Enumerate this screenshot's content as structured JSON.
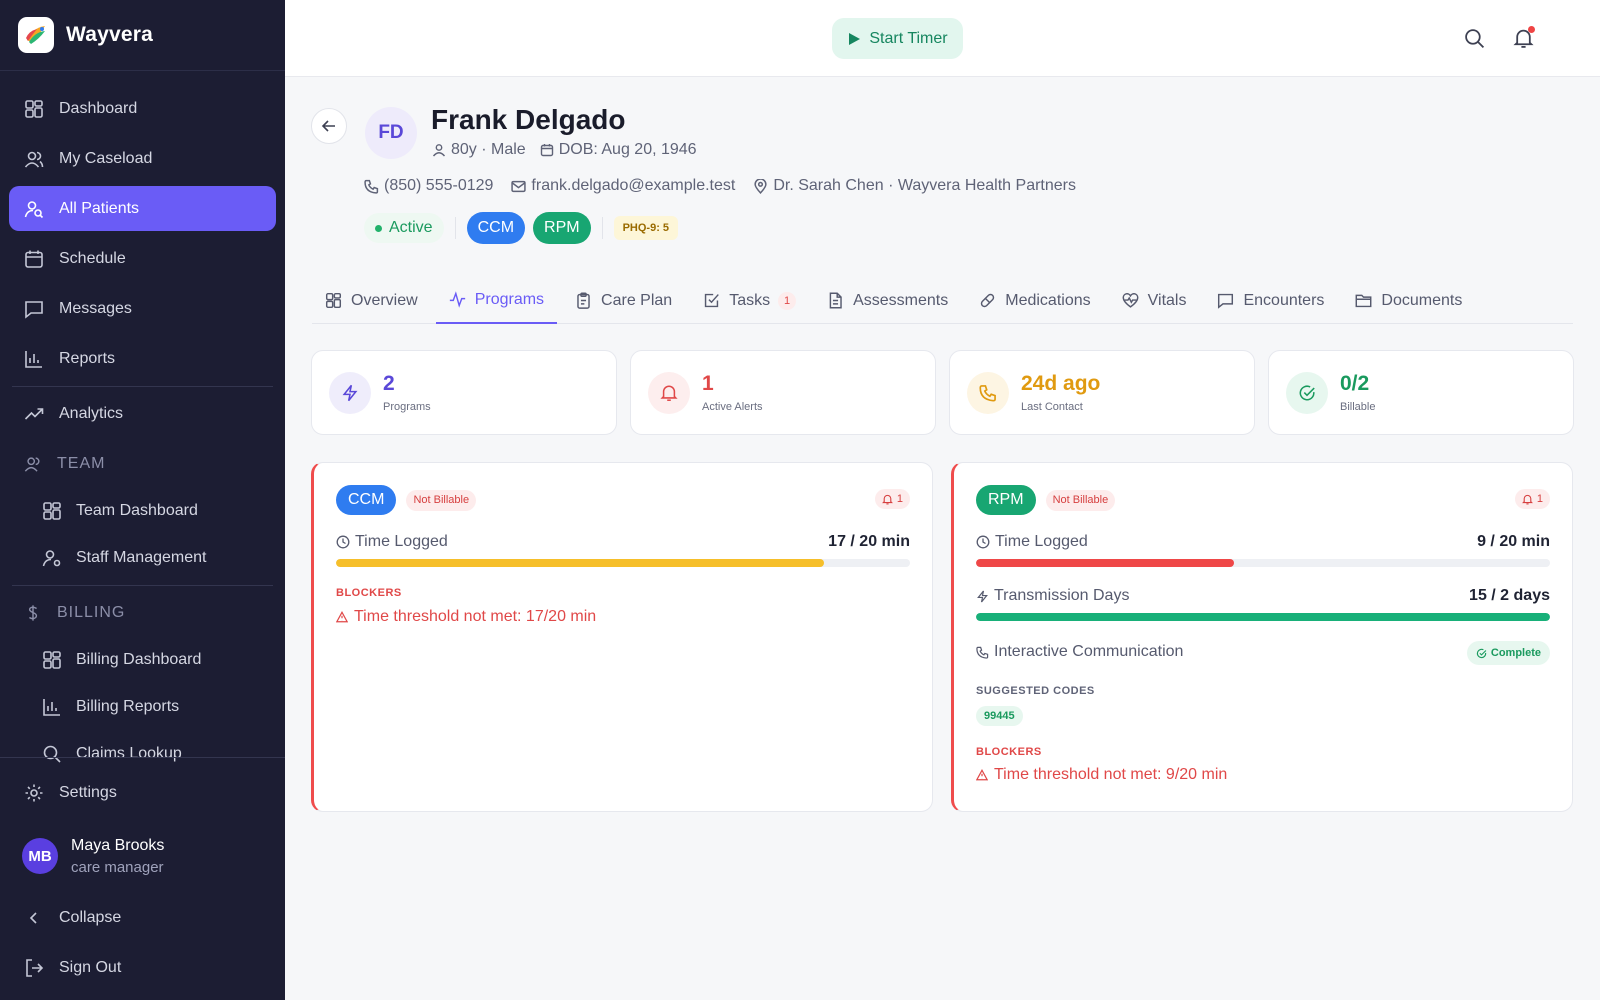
{
  "app": {
    "name": "Wayvera"
  },
  "sidebar": {
    "items": [
      {
        "label": "Dashboard",
        "icon": "grid-icon"
      },
      {
        "label": "My Caseload",
        "icon": "users-icon"
      },
      {
        "label": "All Patients",
        "icon": "user-search-icon",
        "active": true
      },
      {
        "label": "Schedule",
        "icon": "calendar-icon"
      },
      {
        "label": "Messages",
        "icon": "message-icon"
      },
      {
        "label": "Reports",
        "icon": "bar-chart-icon"
      }
    ],
    "analytics": {
      "label": "Analytics",
      "icon": "trending-icon"
    },
    "team": {
      "section": "TEAM",
      "items": [
        {
          "label": "Team Dashboard",
          "icon": "grid-icon"
        },
        {
          "label": "Staff Management",
          "icon": "user-cog-icon"
        }
      ]
    },
    "billing": {
      "section": "BILLING",
      "items": [
        {
          "label": "Billing Dashboard",
          "icon": "grid-icon"
        },
        {
          "label": "Billing Reports",
          "icon": "bar-chart-icon"
        },
        {
          "label": "Claims Lookup",
          "icon": "search-icon"
        }
      ]
    },
    "settings": "Settings",
    "user": {
      "initials": "MB",
      "name": "Maya Brooks",
      "role": "care manager"
    },
    "collapse": "Collapse",
    "sign_out": "Sign Out"
  },
  "topbar": {
    "timer_label": "Start Timer"
  },
  "patient": {
    "initials": "FD",
    "name": "Frank Delgado",
    "age_sex": "80y · Male",
    "dob": "DOB: Aug 20, 1946",
    "phone": "(850) 555-0129",
    "email": "frank.delgado@example.test",
    "provider": "Dr. Sarah Chen · Wayvera Health Partners",
    "status": "Active",
    "programs": [
      "CCM",
      "RPM"
    ],
    "phq": "PHQ-9: 5"
  },
  "tabs": [
    {
      "label": "Overview",
      "icon": "grid-icon"
    },
    {
      "label": "Programs",
      "icon": "activity-icon",
      "active": true
    },
    {
      "label": "Care Plan",
      "icon": "clipboard-icon"
    },
    {
      "label": "Tasks",
      "icon": "check-square-icon",
      "badge": "1"
    },
    {
      "label": "Assessments",
      "icon": "file-text-icon"
    },
    {
      "label": "Medications",
      "icon": "pill-icon"
    },
    {
      "label": "Vitals",
      "icon": "heart-pulse-icon"
    },
    {
      "label": "Encounters",
      "icon": "message-square-icon"
    },
    {
      "label": "Documents",
      "icon": "folder-icon"
    }
  ],
  "stats": [
    {
      "value": "2",
      "label": "Programs",
      "color": "#5a48d8"
    },
    {
      "value": "1",
      "label": "Active Alerts",
      "color": "#e04848"
    },
    {
      "value": "24d ago",
      "label": "Last Contact",
      "color": "#e09a10"
    },
    {
      "value": "0/2",
      "label": "Billable",
      "color": "#1a9a5e"
    }
  ],
  "ccm": {
    "program": "CCM",
    "billing_status": "Not Billable",
    "alerts": "1",
    "time_label": "Time Logged",
    "time_value": "17 / 20 min",
    "time_progress": 0.85,
    "blockers_title": "BLOCKERS",
    "blocker": "Time threshold not met: 17/20 min"
  },
  "rpm": {
    "program": "RPM",
    "billing_status": "Not Billable",
    "alerts": "1",
    "time_label": "Time Logged",
    "time_value": "9 / 20 min",
    "time_progress": 0.45,
    "transmission_label": "Transmission Days",
    "transmission_value": "15 / 2 days",
    "transmission_progress": 1.0,
    "interactive_label": "Interactive Communication",
    "interactive_status": "Complete",
    "codes_title": "SUGGESTED CODES",
    "codes": [
      "99445"
    ],
    "blockers_title": "BLOCKERS",
    "blocker": "Time threshold not met: 9/20 min"
  }
}
